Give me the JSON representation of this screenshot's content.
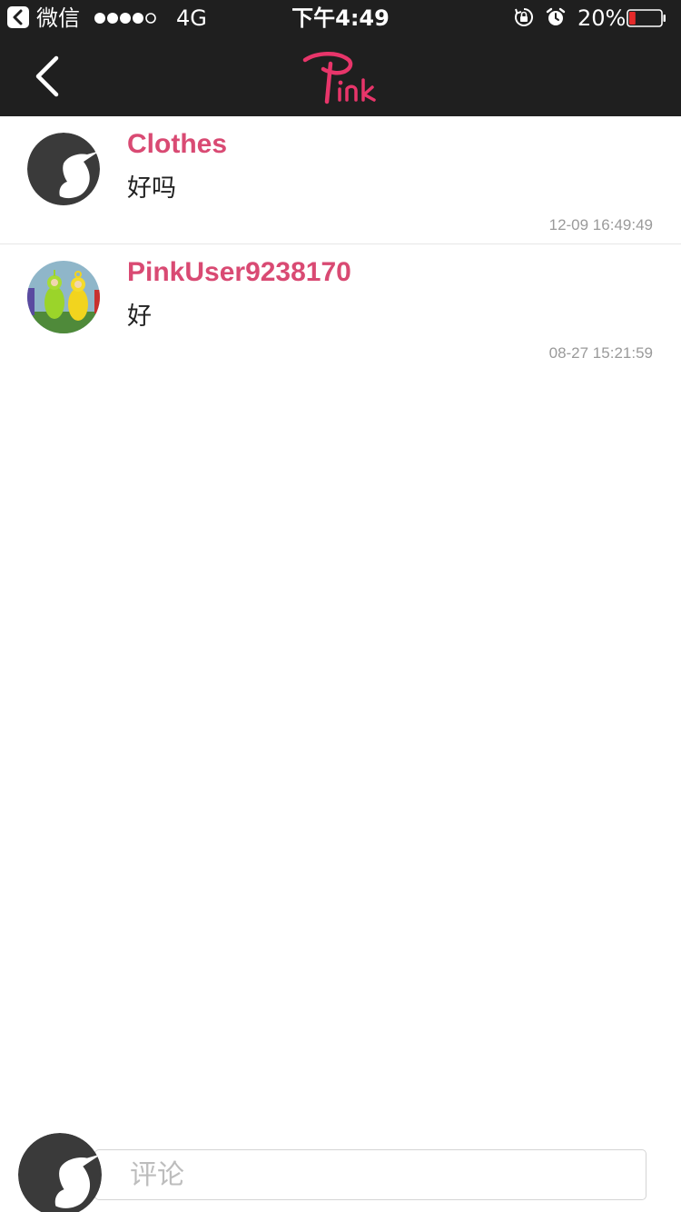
{
  "status_bar": {
    "carrier": "微信",
    "network": "4G",
    "time": "下午4:49",
    "battery": "20%",
    "battery_level": 0.2,
    "signal_bars_filled": 4,
    "signal_bars_total": 5
  },
  "nav": {
    "logo_text": "Pink",
    "brand_color": "#e8356a"
  },
  "comments": [
    {
      "username": "Clothes",
      "text": "好吗",
      "time": "12-09 16:49:49",
      "avatar_icon": "unicorn-icon"
    },
    {
      "username": "PinkUser9238170",
      "text": "好",
      "time": "08-27 15:21:59",
      "avatar_icon": "user-photo"
    }
  ],
  "compose": {
    "placeholder": "评论",
    "avatar_icon": "unicorn-icon"
  },
  "colors": {
    "username": "#d94a73",
    "bar_background": "#1f1f1f",
    "timestamp": "#9a9a9a"
  }
}
